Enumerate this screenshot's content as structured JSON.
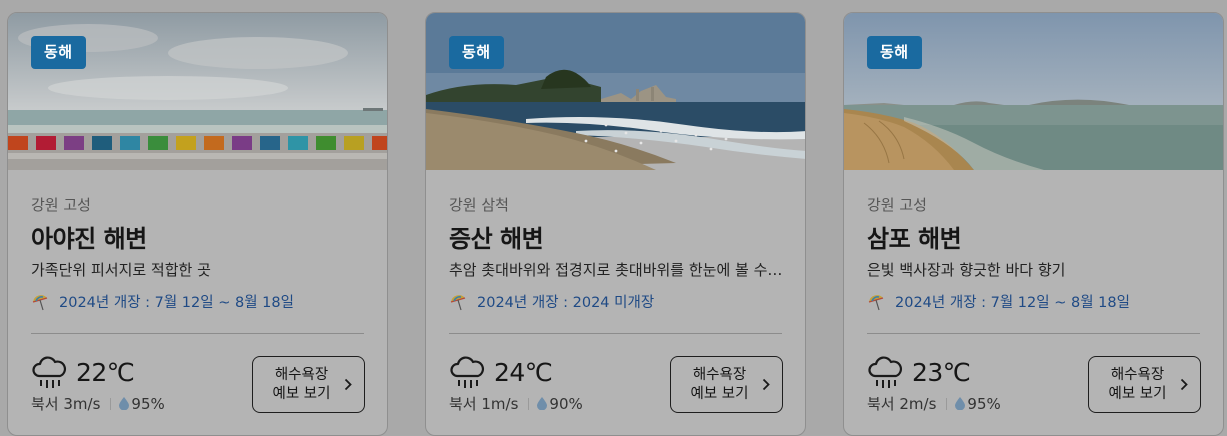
{
  "cards": [
    {
      "badge": "동해",
      "region": "강원 고성",
      "title": "아야진 해변",
      "desc": "가족단위 피서지로 적합한 곳",
      "open_label": "2024년 개장 : 7월 12일 ~ 8월 18일",
      "temperature": "22℃",
      "wind": "북서 3m/s",
      "humidity": "95%",
      "forecast_button": {
        "line1": "해수욕장",
        "line2": "예보 보기"
      }
    },
    {
      "badge": "동해",
      "region": "강원 삼척",
      "title": "증산 해변",
      "desc": "추암 촛대바위와 접경지로 촛대바위를 한눈에 볼 수 있는 해변",
      "open_label": "2024년 개장 : 2024 미개장",
      "temperature": "24℃",
      "wind": "북서 1m/s",
      "humidity": "90%",
      "forecast_button": {
        "line1": "해수욕장",
        "line2": "예보 보기"
      }
    },
    {
      "badge": "동해",
      "region": "강원 고성",
      "title": "삼포 해변",
      "desc": "은빛 백사장과 향긋한 바다 향기",
      "open_label": "2024년 개장 : 7월 12일 ~ 8월 18일",
      "temperature": "23℃",
      "wind": "북서 2m/s",
      "humidity": "95%",
      "forecast_button": {
        "line1": "해수욕장",
        "line2": "예보 보기"
      }
    }
  ],
  "icons": {
    "umbrella": "beach-umbrella-icon",
    "weather": "rain-cloud-icon",
    "humidity": "water-drop-icon",
    "chevron": "chevron-right-icon"
  },
  "colors": {
    "badge": "#1a6aa0",
    "open_text": "#1f4a85",
    "overlay_bg": "#a9a9a9"
  }
}
